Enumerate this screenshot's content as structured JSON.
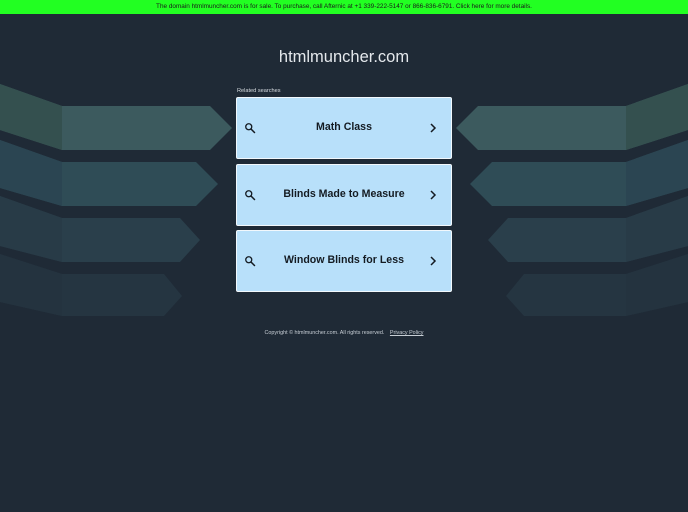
{
  "banner": {
    "text": "The domain htmlmuncher.com is for sale. To purchase, call Afternic at +1 339-222-5147 or 866-836-6791. Click here for more details."
  },
  "header": {
    "domain": "htmlmuncher.com"
  },
  "related": {
    "label": "Related searches",
    "items": [
      {
        "label": "Math Class"
      },
      {
        "label": "Blinds Made to Measure"
      },
      {
        "label": "Window Blinds for Less"
      }
    ]
  },
  "footer": {
    "copyright": "Copyright © htmlmuncher.com.  All rights reserved.",
    "privacy_label": "Privacy Policy"
  },
  "colors": {
    "banner_bg": "#22ff22",
    "page_bg": "#1f2a36",
    "card_bg": "#b8e0fa"
  },
  "icons": {
    "search": "search-icon",
    "chevron": "chevron-right-icon"
  }
}
